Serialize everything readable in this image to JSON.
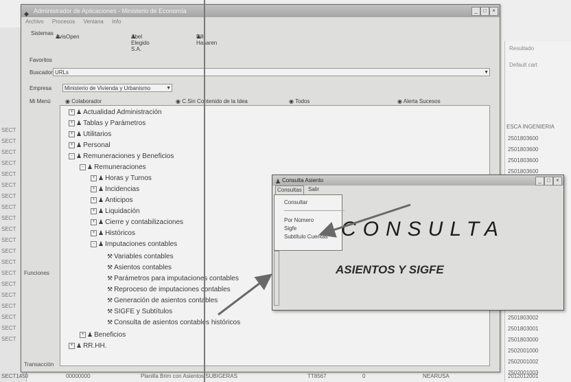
{
  "background": {
    "bottom_status": [
      "SECT1450",
      "00000000",
      "Planilla Brim con Asientos SUBIGERAS",
      "TT8567",
      "0",
      "NEARUSA",
      "2012012001"
    ],
    "right_header": "ESCA INGENIERIA",
    "right_cells": [
      "2501803600",
      "2501803600",
      "2501803600",
      "2501803600",
      "2501803600"
    ],
    "right_cells_bottom": [
      "2501803002",
      "2501803001",
      "2501803000",
      "2502001000",
      "2502001002",
      "2502001003"
    ],
    "left_codes": [
      "SECT",
      "SECT",
      "SECT",
      "SECT",
      "SECT",
      "SECT",
      "SECT",
      "SECT",
      "SECT",
      "SECT",
      "SECT",
      "SECT",
      "SECT",
      "SECT",
      "SECT",
      "SECT",
      "SECT",
      "SECT",
      "SECT",
      "SECT"
    ],
    "right_label1": "Resultado",
    "right_label2": "Default cart"
  },
  "window": {
    "title": "Administrador de Aplicaciones - Ministerio de Economía",
    "menu": [
      "Archivo",
      "Procesos",
      "Ventana",
      "Info"
    ],
    "toolbar": {
      "sistemas_label": "Sistemas",
      "app1": "AvisOpen",
      "app2": "Abel Elegido S.A.",
      "app3": "Bill Hasaren"
    },
    "favoritos": "Favoritos",
    "buscador_label": "Buscador",
    "buscador_value": "URLs",
    "empresa_label": "Empresa",
    "empresa_value": "Ministerio de Vivienda y Urbanismo",
    "menu_label": "Mi Menú",
    "radio1": "Colaborador",
    "radio2": "C.Sin Contenido de la Idea",
    "radio3": "Todos",
    "radio4": "Alerta Sucesos",
    "funciones_label": "Funciones",
    "status": "Transacción"
  },
  "tree": [
    {
      "label": "Actualidad Administración",
      "level": 0,
      "exp": "+"
    },
    {
      "label": "Tablas y Parámetros",
      "level": 0,
      "exp": "+"
    },
    {
      "label": "Utilitarios",
      "level": 0,
      "exp": "+"
    },
    {
      "label": "Personal",
      "level": 0,
      "exp": "+"
    },
    {
      "label": "Remuneraciones y Beneficios",
      "level": 0,
      "exp": "-"
    },
    {
      "label": "Remuneraciones",
      "level": 1,
      "exp": "-"
    },
    {
      "label": "Horas y Turnos",
      "level": 2,
      "exp": "+"
    },
    {
      "label": "Incidencias",
      "level": 2,
      "exp": "+"
    },
    {
      "label": "Anticipos",
      "level": 2,
      "exp": "+"
    },
    {
      "label": "Liquidación",
      "level": 2,
      "exp": "+"
    },
    {
      "label": "Cierre y contabilizaciones",
      "level": 2,
      "exp": "+"
    },
    {
      "label": "Históricos",
      "level": 2,
      "exp": "+"
    },
    {
      "label": "Imputaciones contables",
      "level": 2,
      "exp": "-"
    },
    {
      "label": "Variables contables",
      "level": 3,
      "exp": ""
    },
    {
      "label": "Asientos contables",
      "level": 3,
      "exp": ""
    },
    {
      "label": "Parámetros para imputaciones contables",
      "level": 3,
      "exp": ""
    },
    {
      "label": "Reproceso de imputaciones contables",
      "level": 3,
      "exp": ""
    },
    {
      "label": "Generación de asientos contables",
      "level": 3,
      "exp": ""
    },
    {
      "label": "SIGFE y Subtítulos",
      "level": 3,
      "exp": ""
    },
    {
      "label": "Consulta de asientos contables históricos",
      "level": 3,
      "exp": ""
    },
    {
      "label": "Beneficios",
      "level": 1,
      "exp": "+"
    },
    {
      "label": "RR.HH.",
      "level": 0,
      "exp": "+"
    }
  ],
  "dialog": {
    "title": "Consulta Asiento",
    "menu": [
      "Consultas",
      "Salir"
    ],
    "items": [
      "Consultar",
      "Por Número",
      "Sigfe",
      "Subtítulo Cuentas"
    ],
    "heading": "CONSULTA",
    "subheading": "ASIENTOS Y SIGFE"
  }
}
